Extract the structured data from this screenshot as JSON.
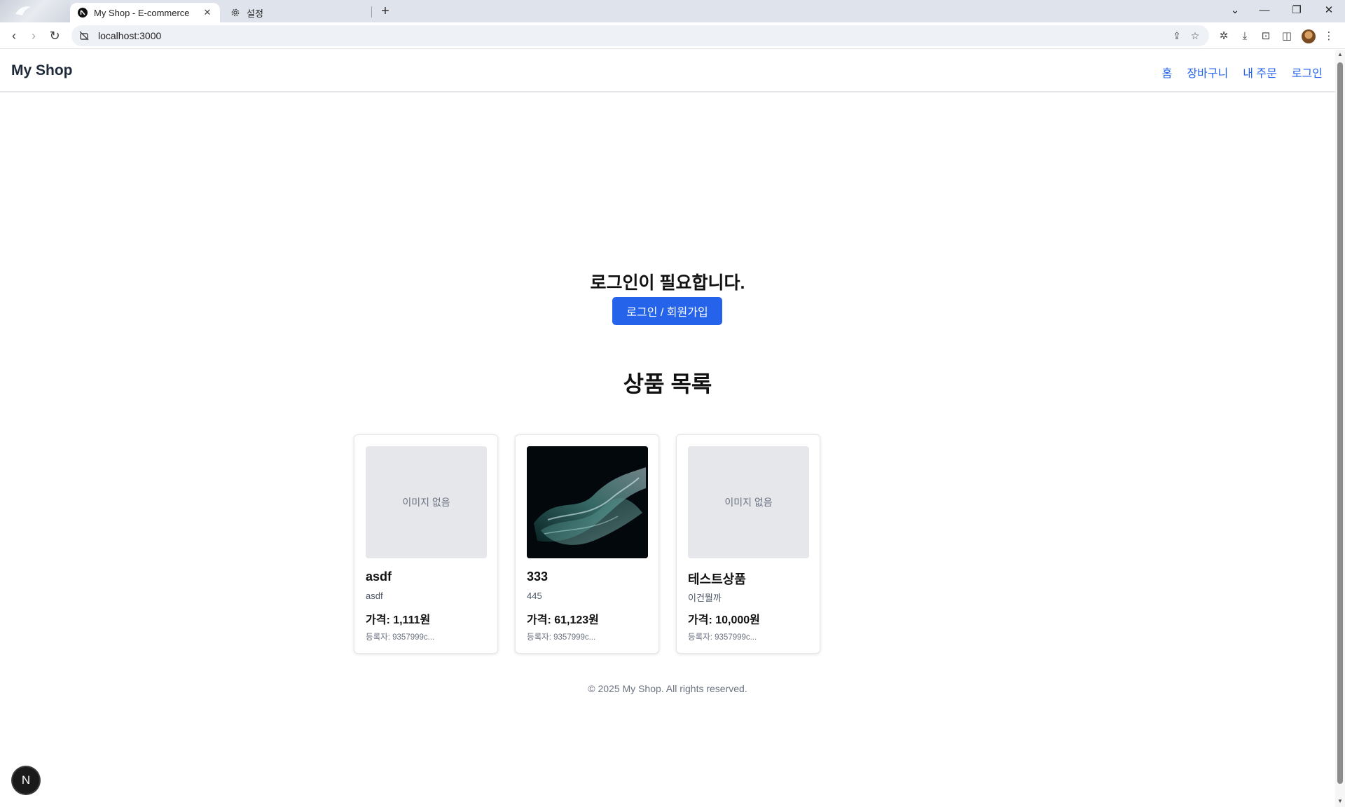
{
  "browser": {
    "tabs": [
      {
        "title": "My Shop - E-commerce",
        "active": true,
        "favicon": "nextjs-icon"
      },
      {
        "title": "설정",
        "active": false,
        "favicon": "gear-icon"
      }
    ],
    "url": "localhost:3000"
  },
  "site": {
    "brand": "My Shop",
    "nav": {
      "home": "홈",
      "cart": "장바구니",
      "orders": "내 주문",
      "login": "로그인"
    }
  },
  "auth_prompt": {
    "message": "로그인이 필요합니다.",
    "button": "로그인 / 회원가입"
  },
  "products": {
    "title": "상품 목록",
    "items": [
      {
        "name": "asdf",
        "description": "asdf",
        "price": "가격: 1,111원",
        "seller": "등록자: 9357999c...",
        "image": "이미지 없음"
      },
      {
        "name": "333",
        "description": "445",
        "price": "가격: 61,123원",
        "seller": "등록자: 9357999c...",
        "image": ""
      },
      {
        "name": "테스트상품",
        "description": "이건뭘까",
        "price": "가격: 10,000원",
        "seller": "등록자: 9357999c...",
        "image": "이미지 없음"
      }
    ]
  },
  "footer": "© 2025 My Shop. All rights reserved.",
  "dev_badge": "N",
  "colors": {
    "accent": "#2563eb",
    "placeholder_bg": "#e5e7eb"
  }
}
